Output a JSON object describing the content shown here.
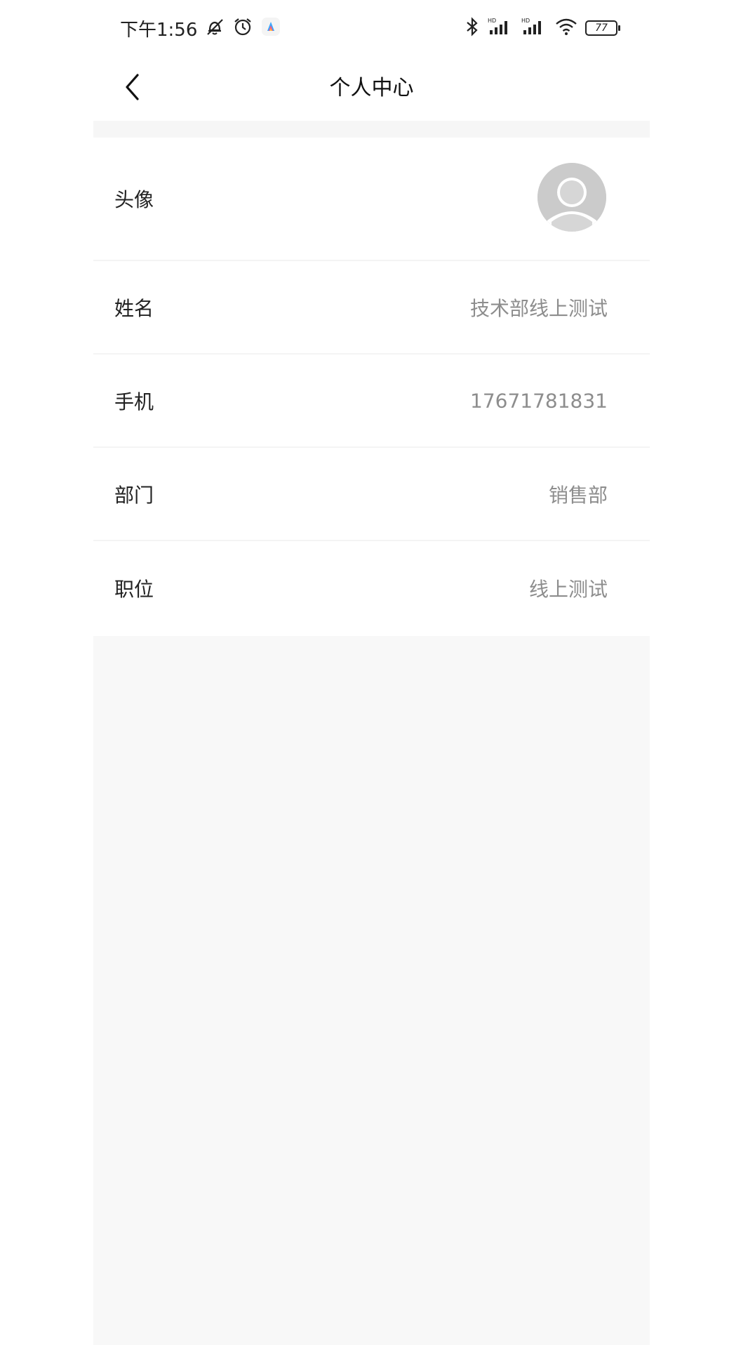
{
  "status_bar": {
    "time": "下午1:56",
    "battery": "77",
    "icons": [
      "mute-bell-icon",
      "alarm-icon",
      "app-notification-icon",
      "bluetooth-icon",
      "hd-signal-icon",
      "hd-signal-icon",
      "wifi-icon",
      "battery-icon"
    ]
  },
  "nav": {
    "title": "个人中心",
    "back_icon": "chevron-left-icon"
  },
  "profile": {
    "avatar_label": "头像",
    "rows": [
      {
        "label": "姓名",
        "value": "技术部线上测试"
      },
      {
        "label": "手机",
        "value": "17671781831"
      },
      {
        "label": "部门",
        "value": "销售部"
      },
      {
        "label": "职位",
        "value": "线上测试"
      }
    ]
  },
  "colors": {
    "background": "#ffffff",
    "section_gap": "#f6f6f6",
    "label_text": "#222222",
    "value_text": "#8d8d8d",
    "avatar_placeholder": "#c9c9c9"
  }
}
